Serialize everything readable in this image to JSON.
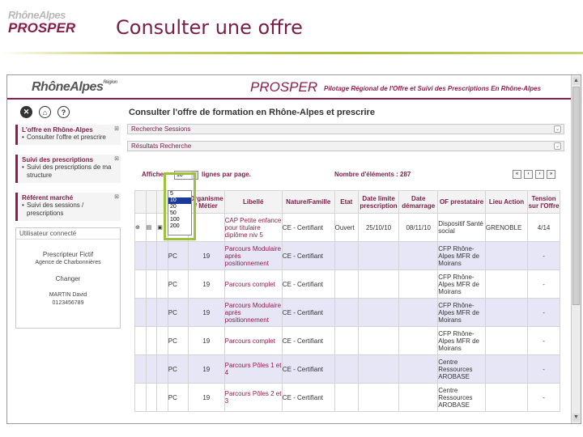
{
  "slide": {
    "logo_top": "RhôneAlpes",
    "logo_bottom": "PROSPER",
    "title": "Consulter une offre"
  },
  "app": {
    "logo": "RhôneAlpes",
    "logo_small": "Région",
    "name": "PROSPER",
    "tagline": "Pilotage Régional de l'Offre et Suivi des Prescriptions En Rhône-Alpes"
  },
  "sidebar": {
    "buttons": [
      {
        "icon": "close-icon",
        "glyph": "✕",
        "color": "#333333"
      },
      {
        "icon": "home-icon",
        "glyph": "⌂",
        "color": "#333333"
      },
      {
        "icon": "help-icon",
        "glyph": "?",
        "color": "#333333"
      }
    ],
    "blocks": [
      {
        "head": "L'offre en Rhône-Alpes",
        "items": [
          "Consulter l'offre et prescrire"
        ]
      },
      {
        "head": "Suivi des prescriptions",
        "items": [
          "Suivi des prescriptions de ma structure"
        ]
      },
      {
        "head": "Référent marché",
        "items": [
          "Suivi des sessions / prescriptions"
        ]
      }
    ],
    "user": {
      "head": "Utilisateur connecté",
      "role": "Prescripteur Fictif",
      "agency": "Agence de Charbonnières",
      "change": "Changer",
      "name": "MARTIN David",
      "phone": "0123456789"
    }
  },
  "main": {
    "heading": "Consulter l'offre de formation en Rhône-Alpes et prescrire",
    "search_bar": "Recherche Sessions",
    "results_bar": "Résultats Recherche",
    "pager": {
      "afficher": "Afficher",
      "selected": "10",
      "per_page": "lignes par page.",
      "count_label": "Nombre d'éléments : 287",
      "options": [
        "5",
        "10",
        "20",
        "50",
        "100",
        "200"
      ]
    }
  },
  "table": {
    "headers": [
      "",
      "",
      "",
      "",
      "Organisme / Métier",
      "Libellé",
      "Nature/Famille",
      "Etat",
      "Date limite prescription",
      "Date démarrage",
      "OF prestataire",
      "Lieu Action",
      "Tension sur l'Offre"
    ],
    "rows": [
      {
        "c1": "",
        "num": "",
        "lib": "CAP Petite enfance pour titulaire diplôme niv 5",
        "nat": "CE - Certifiant",
        "etat": "Ouvert",
        "dlim": "25/10/10",
        "ddem": "08/11/10",
        "of": "Dispositif Santé social",
        "lieu": "GRENOBLE",
        "tension": "4/14"
      },
      {
        "c1": "PC",
        "num": "19",
        "lib": "Parcours Modulaire après positionnement",
        "nat": "CE - Certifiant",
        "etat": "",
        "dlim": "",
        "ddem": "",
        "of": "CFP Rhône-Alpes MFR de Moirans",
        "lieu": "",
        "tension": "-"
      },
      {
        "c1": "PC",
        "num": "19",
        "lib": "Parcours complet",
        "nat": "CE - Certifiant",
        "etat": "",
        "dlim": "",
        "ddem": "",
        "of": "CFP Rhône-Alpes MFR de Moirans",
        "lieu": "",
        "tension": "-"
      },
      {
        "c1": "PC",
        "num": "19",
        "lib": "Parcours Modulaire après positionnement",
        "nat": "CE - Certifiant",
        "etat": "",
        "dlim": "",
        "ddem": "",
        "of": "CFP Rhône-Alpes MFR de Moirans",
        "lieu": "",
        "tension": "-"
      },
      {
        "c1": "PC",
        "num": "19",
        "lib": "Parcours complet",
        "nat": "CE - Certifiant",
        "etat": "",
        "dlim": "",
        "ddem": "",
        "of": "CFP Rhône-Alpes MFR de Moirans",
        "lieu": "",
        "tension": "-"
      },
      {
        "c1": "PC",
        "num": "19",
        "lib": "Parcours Pôles 1 et 4",
        "nat": "CE - Certifiant",
        "etat": "",
        "dlim": "",
        "ddem": "",
        "of": "Centre Ressources AROBASE",
        "lieu": "",
        "tension": "-"
      },
      {
        "c1": "PC",
        "num": "19",
        "lib": "Parcours Pôles 2 et 3",
        "nat": "CE - Certifiant",
        "etat": "",
        "dlim": "",
        "ddem": "",
        "of": "Centre Ressources AROBASE",
        "lieu": "",
        "tension": "-"
      }
    ]
  }
}
